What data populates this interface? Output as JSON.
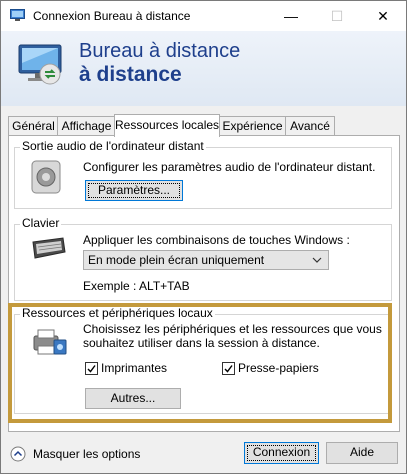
{
  "window": {
    "title": "Connexion Bureau à distance",
    "controls": {
      "minimize": "—",
      "maximize": "☐",
      "close": "✕"
    }
  },
  "header": {
    "brand_line1": "Bureau à distance",
    "brand_line2": "à distance"
  },
  "tabs": [
    {
      "label": "Général",
      "active": false
    },
    {
      "label": "Affichage",
      "active": false
    },
    {
      "label": "Ressources locales",
      "active": true
    },
    {
      "label": "Expérience",
      "active": false
    },
    {
      "label": "Avancé",
      "active": false
    }
  ],
  "audio": {
    "legend": "Sortie audio de l'ordinateur distant",
    "description": "Configurer les paramètres audio de l'ordinateur distant.",
    "button_label": "Paramètres..."
  },
  "keyboard": {
    "legend": "Clavier",
    "description": "Appliquer les combinaisons de touches Windows :",
    "selected_option": "En mode plein écran uniquement",
    "example": "Exemple : ALT+TAB"
  },
  "resources": {
    "legend": "Ressources et périphériques locaux",
    "description_line1": "Choisissez les périphériques et les ressources que vous",
    "description_line2": "souhaitez utiliser dans la session à distance.",
    "printers_label": "Imprimantes",
    "printers_checked": true,
    "clipboard_label": "Presse-papiers",
    "clipboard_checked": true,
    "more_button": "Autres..."
  },
  "footer": {
    "hide_options": "Masquer les options",
    "connect": "Connexion",
    "help": "Aide"
  },
  "colors": {
    "brand": "#1e3f8c",
    "highlight": "#c49a3c",
    "focus": "#0078d7"
  }
}
